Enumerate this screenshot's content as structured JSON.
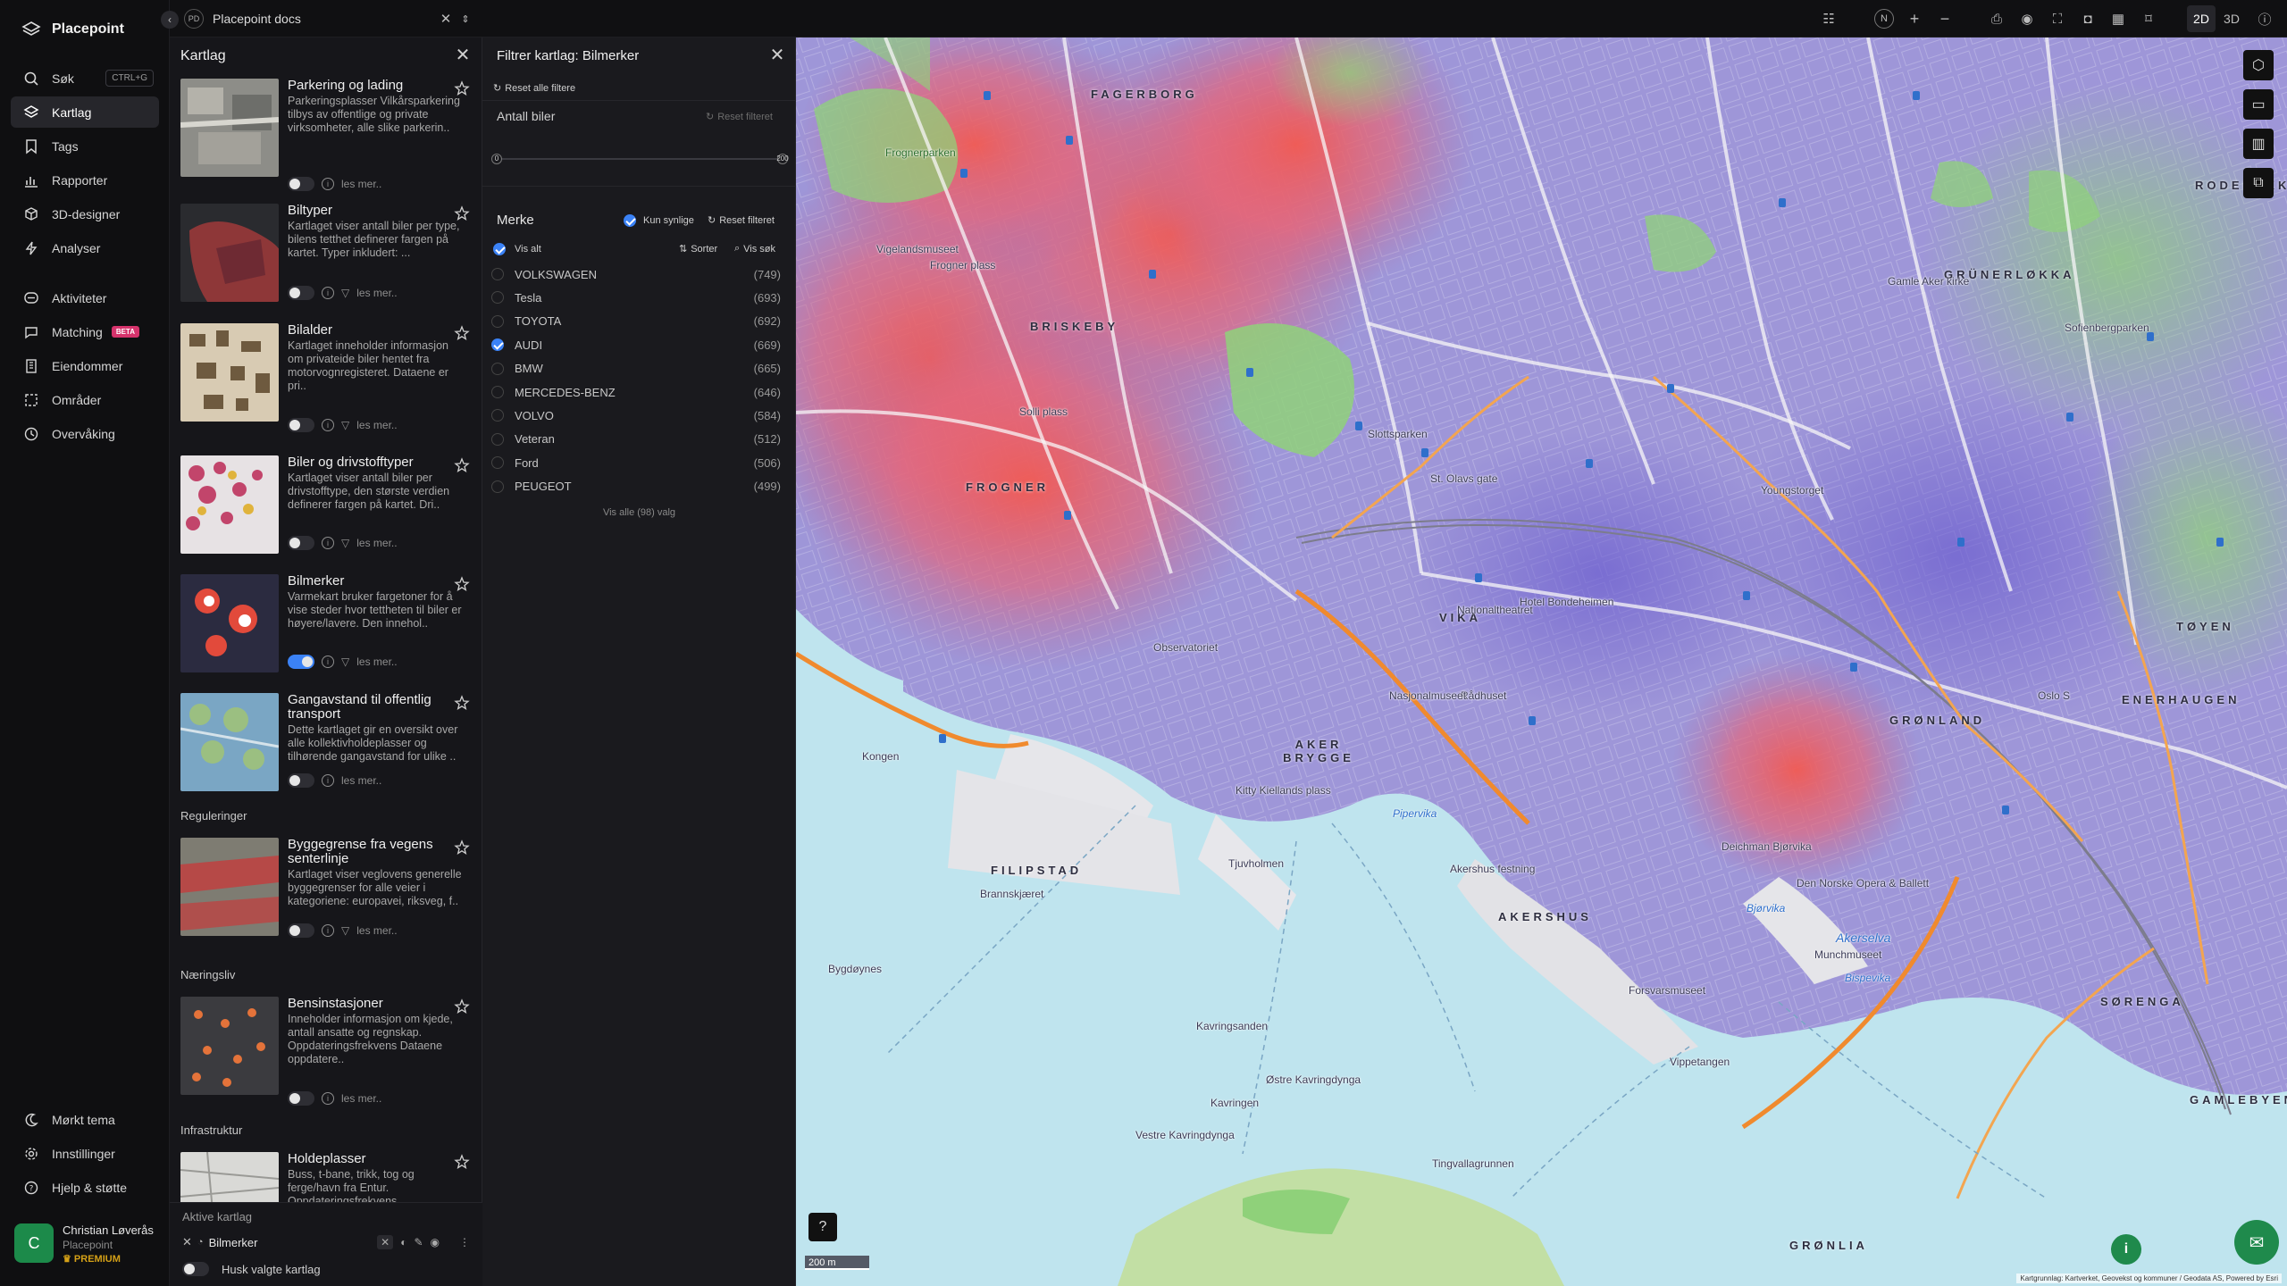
{
  "app": {
    "name": "Placepoint"
  },
  "nav": {
    "items": [
      {
        "label": "Søk",
        "shortcut": "CTRL+G"
      },
      {
        "label": "Kartlag"
      },
      {
        "label": "Tags"
      },
      {
        "label": "Rapporter"
      },
      {
        "label": "3D-designer"
      },
      {
        "label": "Analyser"
      },
      {
        "label": "Aktiviteter"
      },
      {
        "label": "Matching",
        "badge": "BETA"
      },
      {
        "label": "Eiendommer"
      },
      {
        "label": "Områder"
      },
      {
        "label": "Overvåking"
      }
    ],
    "bottom": [
      {
        "label": "Mørkt tema"
      },
      {
        "label": "Innstillinger"
      },
      {
        "label": "Hjelp & støtte"
      }
    ],
    "active_index": 1
  },
  "user": {
    "initial": "C",
    "name": "Christian Løverås",
    "org": "Placepoint",
    "plan": "PREMIUM"
  },
  "topbar": {
    "workspace_badge": "PD",
    "workspace": "Placepoint docs",
    "compass": "N",
    "mode_2d": "2D",
    "mode_3d": "3D"
  },
  "layers_panel": {
    "title": "Kartlag",
    "read_more": "les mer..",
    "layers": [
      {
        "title": "Parkering og lading",
        "desc": "Parkeringsplasser Vilkårsparkering tilbys av offentlige og private virksomheter, alle slike parkerin..",
        "on": false
      },
      {
        "title": "Biltyper",
        "desc": "Kartlaget viser antall biler per type, bilens tetthet definerer fargen på kartet. Typer inkludert: ...",
        "on": false
      },
      {
        "title": "Bilalder",
        "desc": "Kartlaget inneholder informasjon om privateide biler hentet fra motorvognregisteret. Dataene er pri..",
        "on": false
      },
      {
        "title": "Biler og drivstofftyper",
        "desc": "Kartlaget viser antall biler per drivstofftype, den største verdien definerer fargen på kartet. Dri..",
        "on": false
      },
      {
        "title": "Bilmerker",
        "desc": "Varmekart bruker fargetoner for å vise steder hvor tettheten til biler er høyere/lavere. Den innehol..",
        "on": true
      },
      {
        "title": "Gangavstand til offentlig transport",
        "desc": "Dette kartlaget gir en oversikt over alle kollektivholdeplasser og tilhørende gangavstand for ulike ..",
        "on": false
      },
      {
        "title": "Byggegrense fra vegens senterlinje",
        "desc": "Kartlaget viser veglovens generelle byggegrenser for alle veier i kategoriene: europavei, riksveg, f..",
        "on": false
      },
      {
        "title": "Bensinstasjoner",
        "desc": "Inneholder informasjon om kjede, antall ansatte og regnskap. Oppdateringsfrekvens Dataene oppdatere..",
        "on": false
      },
      {
        "title": "Holdeplasser",
        "desc": "Buss, t-bane, trikk, tog og ferge/havn fra Entur. Oppdateringsfrekvens",
        "on": false
      }
    ],
    "sections": [
      "Reguleringer",
      "Næringsliv",
      "Infrastruktur"
    ],
    "active_title": "Aktive kartlag",
    "active_layer": "Bilmerker",
    "remember": "Husk valgte kartlag"
  },
  "filter_panel": {
    "title": "Filtrer kartlag: Bilmerker",
    "reset_all": "Reset alle filtere",
    "count_label": "Antall biler",
    "reset_filter": "Reset filteret",
    "slider_min": "0",
    "slider_max": "200",
    "brand_label": "Merke",
    "only_visible": "Kun synlige",
    "show_all": "Vis alt",
    "sort": "Sorter",
    "search": "Vis søk",
    "brands": [
      {
        "name": "VOLKSWAGEN",
        "count": "(749)",
        "checked": false
      },
      {
        "name": "Tesla",
        "count": "(693)",
        "checked": false
      },
      {
        "name": "TOYOTA",
        "count": "(692)",
        "checked": false
      },
      {
        "name": "AUDI",
        "count": "(669)",
        "checked": true
      },
      {
        "name": "BMW",
        "count": "(665)",
        "checked": false
      },
      {
        "name": "MERCEDES-BENZ",
        "count": "(646)",
        "checked": false
      },
      {
        "name": "VOLVO",
        "count": "(584)",
        "checked": false
      },
      {
        "name": "Veteran",
        "count": "(512)",
        "checked": false
      },
      {
        "name": "Ford",
        "count": "(506)",
        "checked": false
      },
      {
        "name": "PEUGEOT",
        "count": "(499)",
        "checked": false
      }
    ],
    "show_all_options": "Vis alle (98) valg"
  },
  "map": {
    "scale": "200 m",
    "attribution": "Kartgrunnlag: Kartverket, Geovekst og kommuner / Geodata AS, Powered by Esri",
    "districts": [
      "FAGERBORG",
      "BRISKEBY",
      "FROGNER",
      "AKER BRYGGE",
      "FILIPSTAD",
      "AKERSHUS",
      "GRØNLAND",
      "ENERHAUGEN",
      "TØYEN",
      "GRÜNERLØKKA",
      "RODELØKKA",
      "GAMLEBYEN",
      "SØRENGA",
      "GRØNLIA",
      "VIKA"
    ],
    "places": [
      "Frognerparken",
      "Frogner plass",
      "Vigelandsmuseet",
      "Slottsparken",
      "St. Olavs gate",
      "Nationaltheatret",
      "Oslo S",
      "Hotel Bondeheimen",
      "Akershus festning",
      "Tjuvholmen",
      "Kavringsanden",
      "Østre Kavringdynga",
      "Kavringen",
      "Vestre Kavringdynga",
      "Tingvallagrunnen",
      "Bygdøynes",
      "Pipervika",
      "Bjørvika",
      "Bispevika",
      "Akerselva",
      "Gamle Aker kirke",
      "Sofienbergparken",
      "Deichman Bjørvika",
      "Den Norske Opera & Ballett",
      "Munchmuseet",
      "Vippetangen",
      "Forsvarsmuseet",
      "Youngstorget",
      "Rådhuset",
      "Nasjonalmuseet",
      "Brannskjæret",
      "Kongen",
      "Kitty Kiellands plass",
      "Observatoriet",
      "Solli plass"
    ],
    "colors": {
      "heat_high": "#ef5350",
      "heat_low": "#7e6fd6",
      "water": "#bfe4ee",
      "park": "#8fd17a"
    }
  }
}
